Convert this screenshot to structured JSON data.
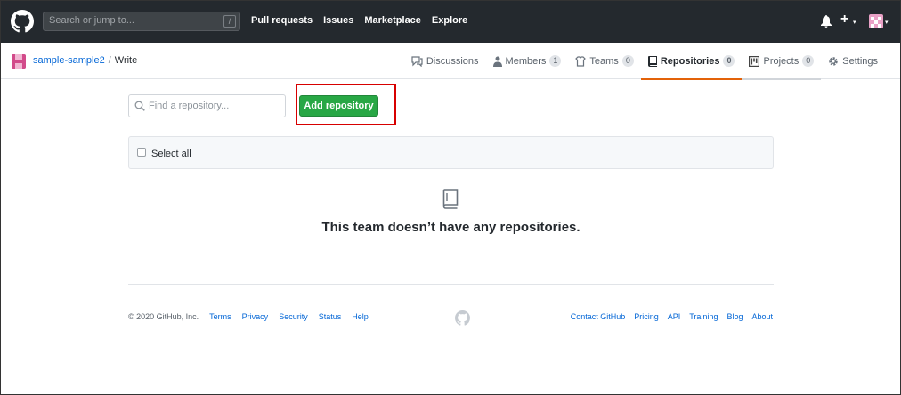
{
  "header": {
    "search_placeholder": "Search or jump to...",
    "search_shortcut": "/",
    "nav": [
      "Pull requests",
      "Issues",
      "Marketplace",
      "Explore"
    ],
    "plus_label": "+",
    "caret": "▾"
  },
  "breadcrumb": {
    "org": "sample-sample2",
    "separator": "/",
    "team": "Write"
  },
  "tabs": [
    {
      "label": "Discussions",
      "count": null,
      "icon": "comment-icon"
    },
    {
      "label": "Members",
      "count": "1",
      "icon": "person-icon"
    },
    {
      "label": "Teams",
      "count": "0",
      "icon": "jersey-icon"
    },
    {
      "label": "Repositories",
      "count": "0",
      "icon": "repo-icon",
      "selected": true
    },
    {
      "label": "Projects",
      "count": "0",
      "icon": "project-icon"
    },
    {
      "label": "Settings",
      "count": null,
      "icon": "gear-icon"
    }
  ],
  "main": {
    "find_placeholder": "Find a repository...",
    "add_button": "Add repository",
    "select_all": "Select all",
    "empty_message": "This team doesn’t have any repositories."
  },
  "footer": {
    "copyright": "© 2020 GitHub, Inc.",
    "left_links": [
      "Terms",
      "Privacy",
      "Security",
      "Status",
      "Help"
    ],
    "right_links": [
      "Contact GitHub",
      "Pricing",
      "API",
      "Training",
      "Blog",
      "About"
    ]
  },
  "colors": {
    "header_bg": "#24292e",
    "primary_button": "#28a745",
    "link": "#0366d6",
    "selected_tab_underline": "#e36209",
    "annotation_box": "#d70000"
  }
}
